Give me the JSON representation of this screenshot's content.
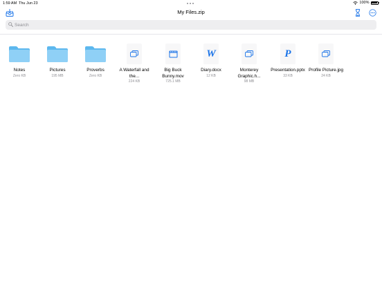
{
  "status": {
    "time": "1:59 AM",
    "date": "Thu Jun 23",
    "battery": "100%"
  },
  "nav": {
    "title": "My Files.zip"
  },
  "search": {
    "placeholder": "Search",
    "value": ""
  },
  "colors": {
    "accent": "#1a73e8",
    "folder": "#7cc6f2",
    "secondary_text": "#8e8e93"
  },
  "files": [
    {
      "name": "Notes",
      "size": "Zero KB",
      "icon": "folder-icon"
    },
    {
      "name": "Pictures",
      "size": "195 MB",
      "icon": "folder-icon"
    },
    {
      "name": "Proverbs",
      "size": "Zero KB",
      "icon": "folder-icon"
    },
    {
      "name": "A Waterfall and the...",
      "size": "224 KB",
      "icon": "generic-file-icon"
    },
    {
      "name": "Big Buck Bunny.mov",
      "size": "725.1 MB",
      "icon": "video-file-icon"
    },
    {
      "name": "Diary.docx",
      "size": "12 KB",
      "icon": "word-doc-icon",
      "letter": "W"
    },
    {
      "name": "Monterey Graphic.h...",
      "size": "98 MB",
      "icon": "generic-file-icon"
    },
    {
      "name": "Presentation.pptx",
      "size": "33 KB",
      "icon": "powerpoint-doc-icon",
      "letter": "P"
    },
    {
      "name": "Profile Picture.jpg",
      "size": "24 KB",
      "icon": "generic-file-icon"
    }
  ]
}
